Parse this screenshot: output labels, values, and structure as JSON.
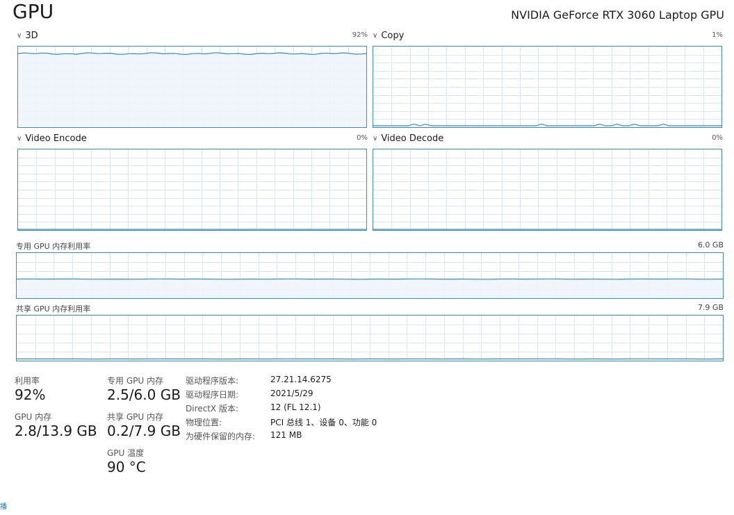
{
  "header": {
    "title": "GPU",
    "device_name": "NVIDIA GeForce RTX 3060 Laptop GPU"
  },
  "engines": [
    {
      "label": "3D",
      "percent": "92%",
      "level": 0.92
    },
    {
      "label": "Copy",
      "percent": "1%",
      "level": 0.01
    },
    {
      "label": "Video Encode",
      "percent": "0%",
      "level": 0.0
    },
    {
      "label": "Video Decode",
      "percent": "0%",
      "level": 0.0
    }
  ],
  "memory_graphs": {
    "dedicated": {
      "label": "专用 GPU 内存利用率",
      "max": "6.0 GB",
      "level": 0.42
    },
    "shared": {
      "label": "共享 GPU 内存利用率",
      "max": "7.9 GB",
      "level": 0.025
    }
  },
  "stats": {
    "utilization": {
      "label": "利用率",
      "value": "92%"
    },
    "gpu_memory": {
      "label": "GPU 内存",
      "value": "2.8/13.9 GB"
    },
    "dedicated_memory": {
      "label": "专用 GPU 内存",
      "value": "2.5/6.0 GB"
    },
    "shared_memory": {
      "label": "共享 GPU 内存",
      "value": "0.2/7.9 GB"
    },
    "temperature": {
      "label": "GPU 温度",
      "value": "90 °C"
    }
  },
  "info": [
    {
      "key": "驱动程序版本:",
      "value": "27.21.14.6275"
    },
    {
      "key": "驱动程序日期:",
      "value": "2021/5/29"
    },
    {
      "key": "DirectX 版本:",
      "value": "12 (FL 12.1)"
    },
    {
      "key": "物理位置:",
      "value": "PCI 总线 1、设备 0、功能 0"
    },
    {
      "key": "为硬件保留的内存:",
      "value": "121 MB"
    }
  ],
  "corner_glyph": "播",
  "colors": {
    "line": "#3a89bf",
    "fill": "#eef5fb",
    "grid": "#d9e6f0"
  }
}
